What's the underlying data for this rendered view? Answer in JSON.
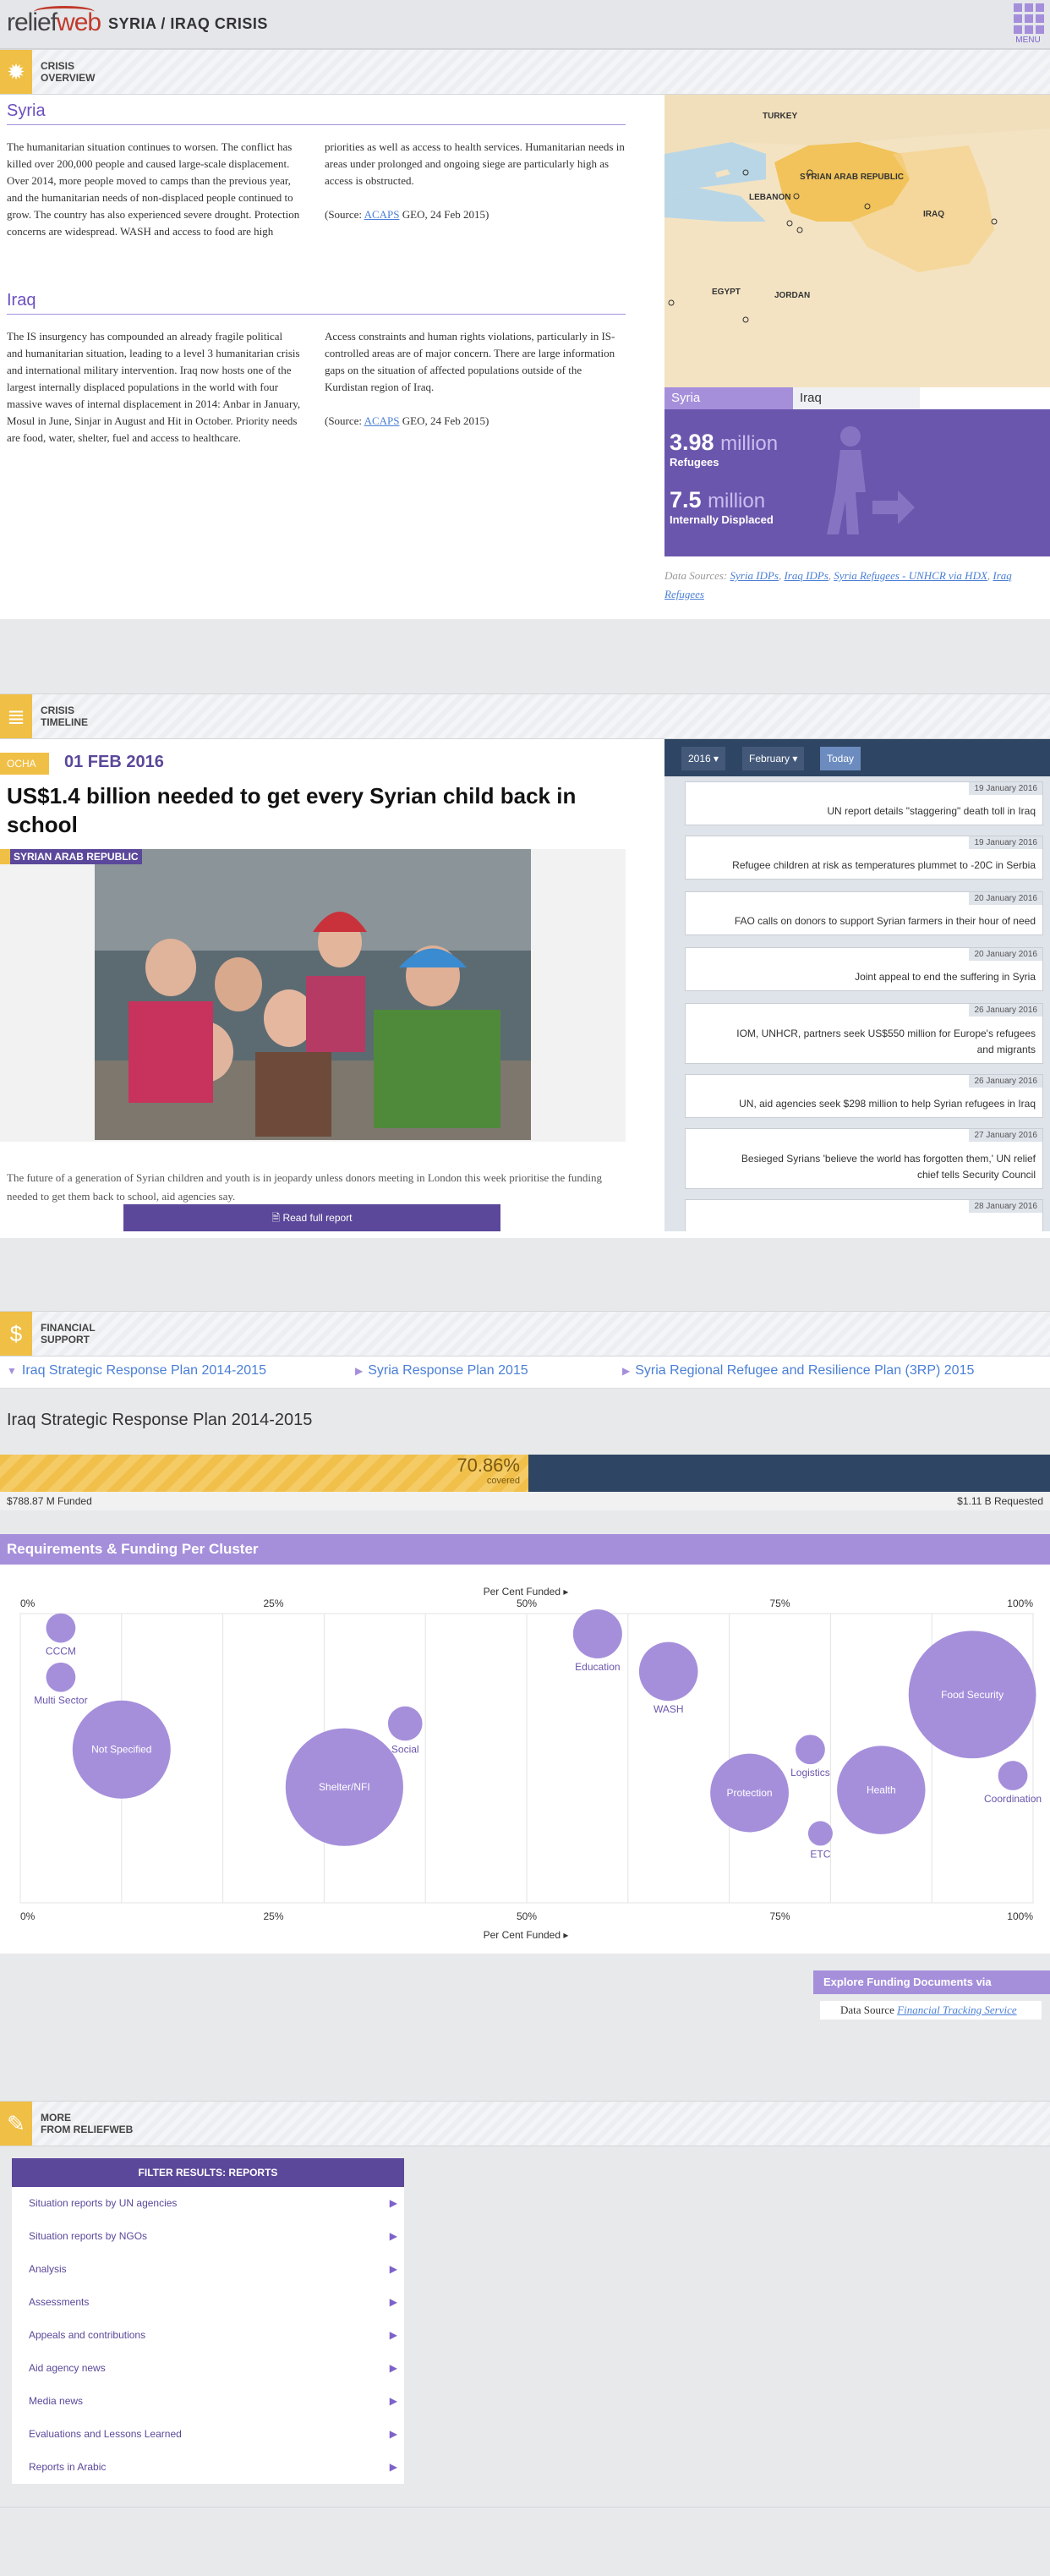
{
  "header": {
    "logo_relief": "relief",
    "logo_web": "web",
    "site_title": "SYRIA / IRAQ CRISIS",
    "menu_label": "MENU"
  },
  "overview": {
    "section_title_1": "CRISIS",
    "section_title_2": "OVERVIEW",
    "syria_heading": "Syria",
    "syria_text_1": "The humanitarian situation continues to worsen. The conflict has killed over 200,000 people and caused large-scale displacement. Over 2014, more people moved to camps than the previous year, and the humanitarian needs of non-displaced people continued to grow. The country has also experienced severe drought. Protection concerns are widespread. WASH and access to food are high",
    "syria_text_2": "priorities as well as access to health services. Humanitarian needs in areas under prolonged and ongoing siege are particularly high as access is obstructed.",
    "syria_source_pre": "(Source: ",
    "syria_source_link": "ACAPS",
    "syria_source_post": " GEO, 24 Feb 2015)",
    "iraq_heading": "Iraq",
    "iraq_text_1": "The IS insurgency has compounded an already fragile political and humanitarian situation, leading to a level 3 humanitarian crisis and international military intervention. Iraq now hosts one of the largest internally displaced populations in the world with four massive waves of internal displacement in 2014: Anbar in January, Mosul in June, Sinjar in August and Hit in October. Priority needs are food, water, shelter, fuel and access to healthcare.",
    "iraq_text_2": "Access constraints and human rights violations, particularly in IS-controlled areas are of major concern. There are large information gaps on the situation of affected populations outside of the Kurdistan region of Iraq.",
    "iraq_source_pre": "(Source: ",
    "iraq_source_link": "ACAPS",
    "iraq_source_post": " GEO, 24 Feb 2015)",
    "map_labels": {
      "turkey": "TURKEY",
      "syria": "SYRIAN ARAB REPUBLIC",
      "lebanon": "LEBANON",
      "iraq": "IRAQ",
      "egypt": "EGYPT",
      "jordan": "JORDAN"
    },
    "tabs": [
      {
        "label": "Syria",
        "active": true
      },
      {
        "label": "Iraq",
        "active": false
      }
    ],
    "refugees_num": "3.98",
    "refugees_unit": "million",
    "refugees_label": "Refugees",
    "idp_num": "7.5",
    "idp_unit": "million",
    "idp_label": "Internally Displaced",
    "data_sources_label": "Data Sources: ",
    "data_sources_links": [
      "Syria IDPs",
      "Iraq IDPs",
      "Syria Refugees - UNHCR via HDX",
      "Iraq Refugees"
    ]
  },
  "timeline": {
    "section_title_1": "CRISIS",
    "section_title_2": "TIMELINE",
    "source_tag": "OCHA",
    "date": "01 FEB 2016",
    "headline": "US$1.4 billion needed to get every Syrian child back in school",
    "country_tag": "SYRIAN ARAB REPUBLIC",
    "summary": "The future of a generation of Syrian children and youth is in jeopardy unless donors meeting in London this week prioritise the funding needed to get them back to school, aid agencies say.",
    "read_label": "Read full report",
    "year": "2016",
    "month": "February",
    "today": "Today",
    "items": [
      {
        "date": "19 January 2016",
        "title": "UN report details \"staggering\" death toll in Iraq"
      },
      {
        "date": "19 January 2016",
        "title": "Refugee children at risk as temperatures plummet to -20C in Serbia"
      },
      {
        "date": "20 January 2016",
        "title": "FAO calls on donors to support Syrian farmers in their hour of need"
      },
      {
        "date": "20 January 2016",
        "title": "Joint appeal to end the suffering in Syria"
      },
      {
        "date": "26 January 2016",
        "title": "IOM, UNHCR, partners seek US$550 million for Europe's refugees and migrants"
      },
      {
        "date": "26 January 2016",
        "title": "UN, aid agencies seek $298 million to help Syrian refugees in Iraq"
      },
      {
        "date": "27 January 2016",
        "title": "Besieged Syrians 'believe the world has forgotten them,' UN relief chief tells Security Council"
      },
      {
        "date": "28 January 2016",
        "title": ""
      }
    ]
  },
  "financial": {
    "section_title_1": "FINANCIAL",
    "section_title_2": "SUPPORT",
    "plan_tabs": [
      {
        "label": "Iraq Strategic Response Plan 2014-2015",
        "active": true
      },
      {
        "label": "Syria Response Plan 2015",
        "active": false
      },
      {
        "label": "Syria Regional Refugee and Resilience Plan (3RP) 2015",
        "active": false
      }
    ],
    "plan_title": "Iraq Strategic Response Plan 2014-2015",
    "covered_pct": 70.86,
    "covered_pct_label": "70.86%",
    "covered_label": "covered",
    "funded_label": "$788.87 M Funded",
    "requested_label": "$1.11 B Requested",
    "req_heading": "Requirements & Funding Per Cluster",
    "axis_title": "Per Cent Funded",
    "x_ticks": [
      "0%",
      "25%",
      "50%",
      "75%",
      "100%"
    ],
    "explore_label": "Explore Funding Documents via ReliefWeb",
    "data_source_label": "Data Source",
    "data_source_link": "Financial Tracking Service"
  },
  "chart_data": {
    "type": "scatter",
    "xlabel": "Per Cent Funded",
    "xlim": [
      0,
      100
    ],
    "x_ticks": [
      "0%",
      "25%",
      "50%",
      "75%",
      "100%"
    ],
    "grid": true,
    "points": [
      {
        "name": "CCCM",
        "x": 4,
        "y": 0.05,
        "r": 0.3,
        "label_pos": "below"
      },
      {
        "name": "Multi Sector",
        "x": 4,
        "y": 0.22,
        "r": 0.3,
        "label_pos": "below"
      },
      {
        "name": "Not Specified",
        "x": 10,
        "y": 0.47,
        "r": 1.0,
        "label_pos": "center"
      },
      {
        "name": "Education",
        "x": 57,
        "y": 0.07,
        "r": 0.5,
        "label_pos": "below"
      },
      {
        "name": "WASH",
        "x": 64,
        "y": 0.2,
        "r": 0.6,
        "label_pos": "below"
      },
      {
        "name": "Social",
        "x": 38,
        "y": 0.38,
        "r": 0.35,
        "label_pos": "below"
      },
      {
        "name": "Shelter/NFI",
        "x": 32,
        "y": 0.6,
        "r": 1.2,
        "label_pos": "center"
      },
      {
        "name": "Food Security",
        "x": 94,
        "y": 0.28,
        "r": 1.3,
        "label_pos": "center"
      },
      {
        "name": "Logistics",
        "x": 78,
        "y": 0.47,
        "r": 0.3,
        "label_pos": "below"
      },
      {
        "name": "Protection",
        "x": 72,
        "y": 0.62,
        "r": 0.8,
        "label_pos": "center"
      },
      {
        "name": "Health",
        "x": 85,
        "y": 0.61,
        "r": 0.9,
        "label_pos": "center"
      },
      {
        "name": "Coordination",
        "x": 98,
        "y": 0.56,
        "r": 0.3,
        "label_pos": "below"
      },
      {
        "name": "ETC",
        "x": 79,
        "y": 0.76,
        "r": 0.25,
        "label_pos": "below"
      }
    ],
    "color": "#a58fdb"
  },
  "more": {
    "section_title_1": "MORE",
    "section_title_2": "FROM RELIEFWEB",
    "filter_heading": "FILTER RESULTS: REPORTS",
    "items": [
      "Situation reports by UN agencies",
      "Situation reports by NGOs",
      "Analysis",
      "Assessments",
      "Appeals and contributions",
      "Aid agency news",
      "Media news",
      "Evaluations and Lessons Learned",
      "Reports in Arabic"
    ]
  },
  "colors": {
    "accent": "#6b56ad",
    "brand_red": "#c03a2b",
    "yellow": "#f0bf45",
    "navy": "#2e4663"
  }
}
